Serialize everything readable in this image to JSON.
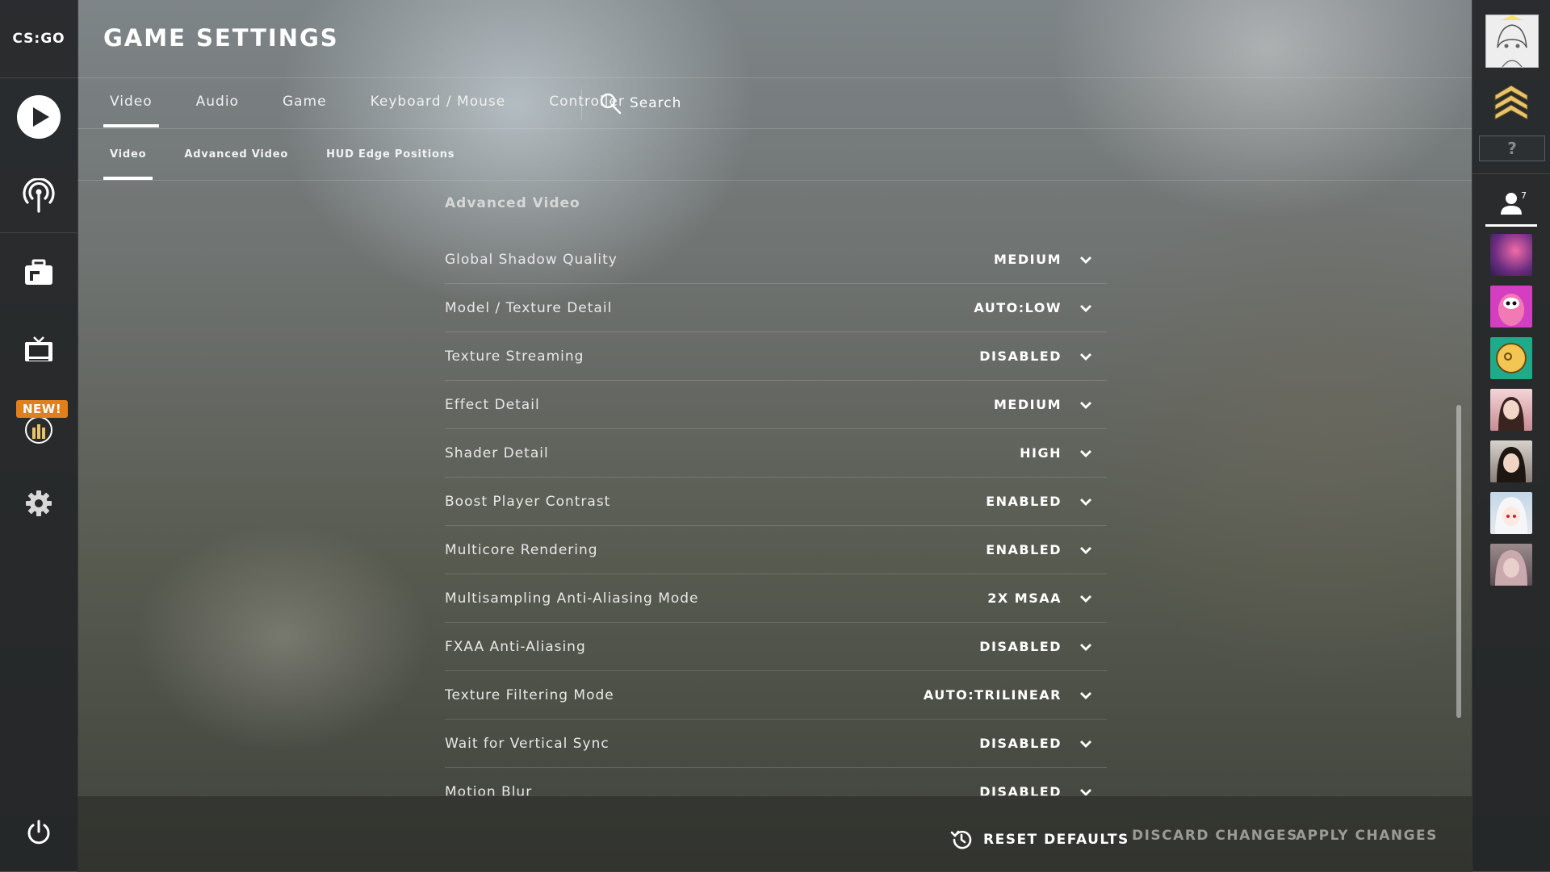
{
  "logo": {
    "text": "CS:GO"
  },
  "header": {
    "title": "GAME SETTINGS"
  },
  "tabs": [
    {
      "label": "Video"
    },
    {
      "label": "Audio"
    },
    {
      "label": "Game"
    },
    {
      "label": "Keyboard / Mouse"
    },
    {
      "label": "Controller"
    }
  ],
  "search": {
    "label": "Search"
  },
  "subtabs": [
    {
      "label": "Video"
    },
    {
      "label": "Advanced Video"
    },
    {
      "label": "HUD Edge Positions"
    }
  ],
  "sidebar": {
    "new_badge": "NEW!"
  },
  "section": {
    "title": "Advanced Video"
  },
  "settings": [
    {
      "label": "Global Shadow Quality",
      "value": "MEDIUM"
    },
    {
      "label": "Model / Texture Detail",
      "value": "AUTO:LOW"
    },
    {
      "label": "Texture Streaming",
      "value": "DISABLED"
    },
    {
      "label": "Effect Detail",
      "value": "MEDIUM"
    },
    {
      "label": "Shader Detail",
      "value": "HIGH"
    },
    {
      "label": "Boost Player Contrast",
      "value": "ENABLED"
    },
    {
      "label": "Multicore Rendering",
      "value": "ENABLED"
    },
    {
      "label": "Multisampling Anti-Aliasing Mode",
      "value": "2X MSAA"
    },
    {
      "label": "FXAA Anti-Aliasing",
      "value": "DISABLED"
    },
    {
      "label": "Texture Filtering Mode",
      "value": "AUTO:TRILINEAR"
    },
    {
      "label": "Wait for Vertical Sync",
      "value": "DISABLED"
    },
    {
      "label": "Motion Blur",
      "value": "DISABLED"
    }
  ],
  "footer": {
    "reset": "RESET DEFAULTS",
    "discard": "DISCARD CHANGES",
    "apply": "APPLY CHANGES"
  },
  "friends": {
    "count": "7"
  },
  "rank": {
    "placeholder": "?"
  },
  "colors": {
    "new_badge": "#e07f1c",
    "rank_chevron": "#e8c36a",
    "disabled_text": "#9a9a96"
  }
}
